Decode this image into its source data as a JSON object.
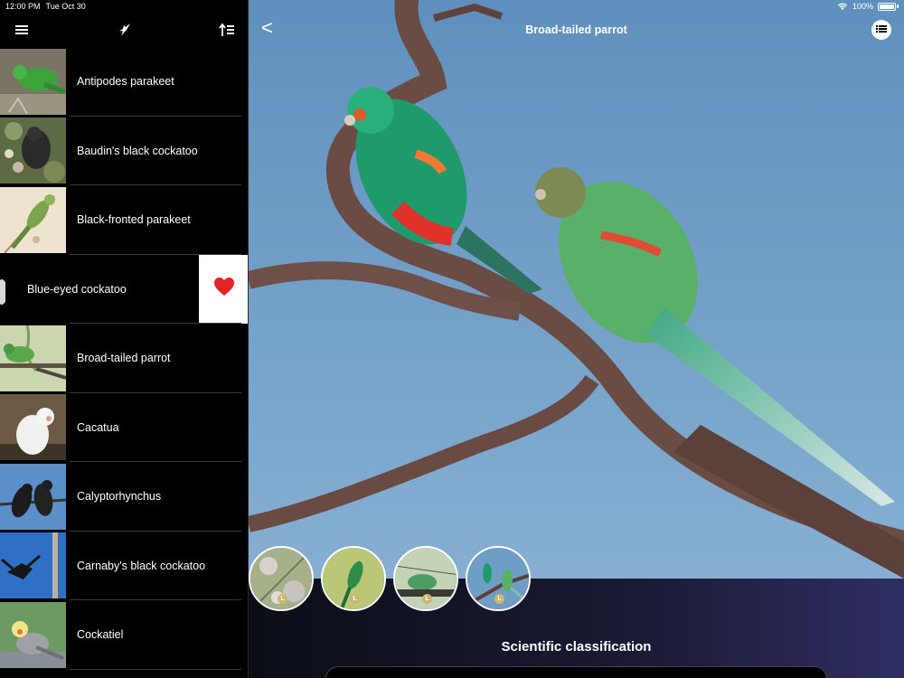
{
  "status_bar": {
    "time": "12:00 PM",
    "date": "Tue Oct 30",
    "battery": "100%"
  },
  "sidebar": {
    "toolbar_icons": [
      "menu-icon",
      "bird-logo-icon",
      "sort-icon"
    ],
    "items": [
      {
        "label": "Antipodes parakeet"
      },
      {
        "label": "Baudin's black cockatoo"
      },
      {
        "label": "Black-fronted parakeet"
      },
      {
        "label": "Blue-eyed cockatoo",
        "swiped": true,
        "action": "heart-icon",
        "action_color": "#e52226"
      },
      {
        "label": "Broad-tailed parrot"
      },
      {
        "label": "Cacatua"
      },
      {
        "label": "Calyptorhynchus"
      },
      {
        "label": "Carnaby's black cockatoo"
      },
      {
        "label": "Cockatiel"
      }
    ]
  },
  "detail": {
    "back_label": "<",
    "title": "Broad-tailed parrot",
    "gallery": [
      {
        "badge": "L"
      },
      {
        "badge": "L"
      },
      {
        "badge": "L"
      },
      {
        "badge": "L"
      }
    ],
    "section_title": "Scientific classification"
  },
  "colors": {
    "sky": "#6c9cc4",
    "accent_heart": "#e52226",
    "panel_dark": "#0b0d16",
    "panel_light": "#2f2e63"
  }
}
